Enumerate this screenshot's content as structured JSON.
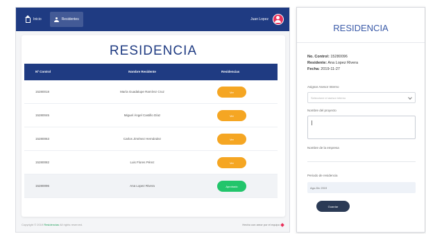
{
  "nav": {
    "items": [
      {
        "label": "Inicio",
        "icon": "home-icon"
      },
      {
        "label": "Residentes",
        "icon": "user-icon"
      }
    ],
    "user_name": "Juan Lopez"
  },
  "panel": {
    "title": "RESIDENCIA",
    "columns": [
      "Nº Control",
      "Nombre Residente",
      "Residencias"
    ],
    "rows": [
      {
        "control": "15280018",
        "name": "María Guadalupe Ramírez Cruz",
        "status": "Ver",
        "state": "pending"
      },
      {
        "control": "15280045",
        "name": "Miguel Ángel Castillo Díaz",
        "status": "Ver",
        "state": "pending"
      },
      {
        "control": "15280063",
        "name": "Carlos Jiménez Hernández",
        "status": "Ver",
        "state": "pending"
      },
      {
        "control": "15280082",
        "name": "Luis Flores Pérez",
        "status": "Ver",
        "state": "pending"
      },
      {
        "control": "15280096",
        "name": "Ana Lopez Rivera",
        "status": "Aprobado",
        "state": "done"
      }
    ]
  },
  "footer": {
    "copyright_prefix": "Copyright © 2019",
    "brand": "Residencias",
    "copyright_suffix": "All rights reserved.",
    "made_with": "Hecho con amor por el equipo"
  },
  "form": {
    "title": "RESIDENCIA",
    "info": {
      "control_label": "No. Control:",
      "control_value": "15280096",
      "residente_label": "Residente:",
      "residente_value": "Ana Lopez Rivera",
      "fecha_label": "Fecha:",
      "fecha_value": "2019-11-27"
    },
    "labels": {
      "asesor": "Asignar Asesor Interno",
      "nombre_proyecto": "Nombre del proyecto",
      "nombre_empresa": "Nombre de la empresa",
      "periodo": "Periodo de residencia"
    },
    "asesor_placeholder": "Seleccione el asesor interno",
    "periodo_value": "Ago-Dic 2019",
    "save_label": "Guardar"
  },
  "colors": {
    "primary": "#1f3b82",
    "pending": "#f5a623",
    "approved": "#22c56b",
    "avatar": "#e8315b"
  }
}
